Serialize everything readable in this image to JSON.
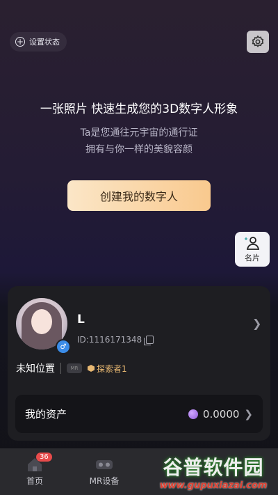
{
  "top": {
    "status_button_label": "设置状态"
  },
  "hero": {
    "headline": "一张照片 快速生成您的3D数字人形象",
    "subline1": "Ta是您通往元宇宙的通行证",
    "subline2": "拥有与你一样的美貌容颜",
    "create_button_label": "创建我的数字人"
  },
  "side": {
    "card_button_label": "名片"
  },
  "profile": {
    "username": "L",
    "user_id": "ID:1116171348",
    "location": "未知位置",
    "mr_badge": "MR",
    "explorer_level": "探索者1"
  },
  "assets": {
    "label": "我的资产",
    "value": "0.0000"
  },
  "tabs": [
    {
      "label": "首页",
      "badge": "36"
    },
    {
      "label": "MR设备"
    },
    {
      "label": ""
    },
    {
      "label": ""
    }
  ],
  "watermark": {
    "title": "谷普软件园",
    "url": "www.gupuxiazai.com"
  },
  "colors": {
    "accent": "#f9c98e",
    "badge": "#e84b4b",
    "explorer": "#e8b872",
    "gender": "#3b8ce8"
  }
}
